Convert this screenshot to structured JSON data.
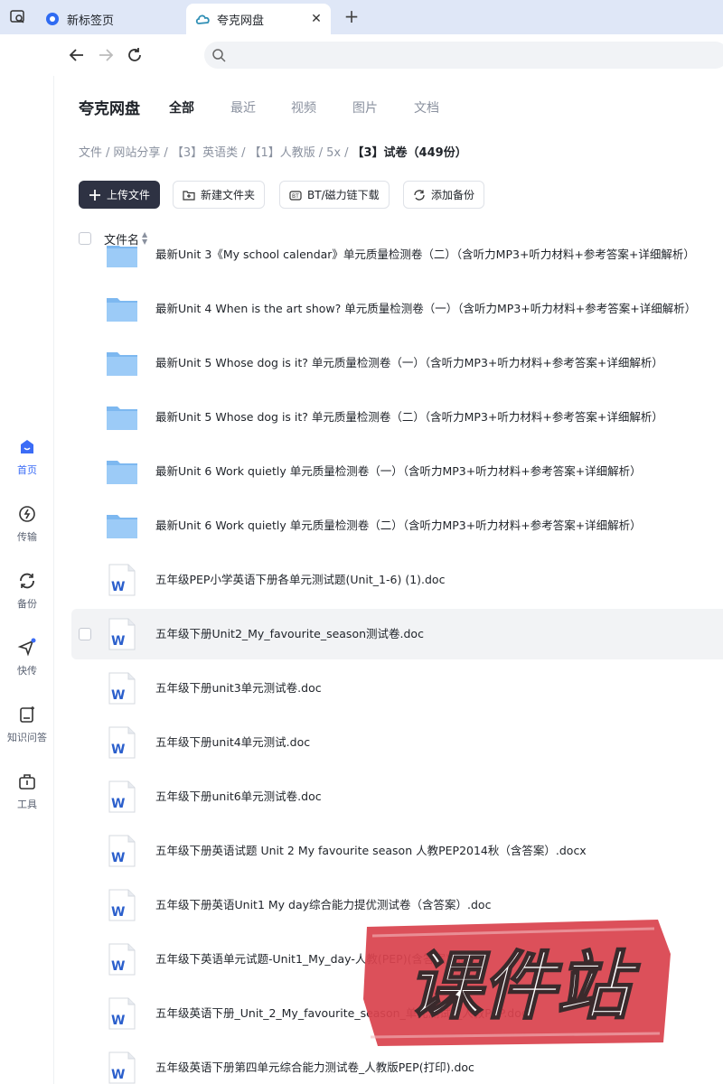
{
  "browser": {
    "tabs": [
      {
        "label": "新标签页",
        "active": false
      },
      {
        "label": "夸克网盘",
        "active": true
      }
    ],
    "new_tab_label": "+",
    "close_label": "✕"
  },
  "rail": {
    "items": [
      {
        "label": "首页",
        "icon": "home-icon",
        "active": true
      },
      {
        "label": "传输",
        "icon": "transfer-icon",
        "active": false
      },
      {
        "label": "备份",
        "icon": "backup-icon",
        "active": false
      },
      {
        "label": "快传",
        "icon": "quick-send-icon",
        "active": false
      },
      {
        "label": "知识问答",
        "icon": "qa-icon",
        "active": false
      },
      {
        "label": "工具",
        "icon": "toolbox-icon",
        "active": false
      }
    ]
  },
  "header": {
    "brand": "夸克网盘",
    "categories": [
      "全部",
      "最近",
      "视频",
      "图片",
      "文档"
    ]
  },
  "breadcrumb": [
    "文件",
    "网站分享",
    "【3】英语类",
    "【1】人教版",
    "5x",
    "【3】试卷（449份）"
  ],
  "toolbar": {
    "upload": "上传文件",
    "new_folder": "新建文件夹",
    "bt": "BT/磁力链下载",
    "backup": "添加备份"
  },
  "list_header": {
    "name": "文件名"
  },
  "files": [
    {
      "name": "最新Unit 3《My school calendar》单元质量检测卷（二）（含听力MP3+听力材料+参考答案+详细解析）",
      "type": "folder"
    },
    {
      "name": "最新Unit 4 When is the art show?  单元质量检测卷（一）（含听力MP3+听力材料+参考答案+详细解析）",
      "type": "folder"
    },
    {
      "name": "最新Unit 5 Whose dog is it?  单元质量检测卷（一）（含听力MP3+听力材料+参考答案+详细解析）",
      "type": "folder"
    },
    {
      "name": "最新Unit 5 Whose dog is it?  单元质量检测卷（二）（含听力MP3+听力材料+参考答案+详细解析）",
      "type": "folder"
    },
    {
      "name": "最新Unit 6 Work quietly 单元质量检测卷（一）（含听力MP3+听力材料+参考答案+详细解析）",
      "type": "folder"
    },
    {
      "name": "最新Unit 6 Work quietly 单元质量检测卷（二）（含听力MP3+听力材料+参考答案+详细解析）",
      "type": "folder"
    },
    {
      "name": "五年级PEP小学英语下册各单元测试题(Unit_1-6) (1).doc",
      "type": "doc"
    },
    {
      "name": "五年级下册Unit2_My_favourite_season测试卷.doc",
      "type": "doc"
    },
    {
      "name": "五年级下册unit3单元测试卷.doc",
      "type": "doc"
    },
    {
      "name": "五年级下册unit4单元测试.doc",
      "type": "doc"
    },
    {
      "name": "五年级下册unit6单元测试卷.doc",
      "type": "doc"
    },
    {
      "name": "五年级下册英语试题 Unit 2   My favourite season 人教PEP2014秋（含答案）.docx",
      "type": "doc"
    },
    {
      "name": "五年级下册英语Unit1 My day综合能力提优测试卷（含答案）.doc",
      "type": "doc"
    },
    {
      "name": "五年级下英语单元试题-Unit1_My_day-人教(PEP)(含答案).doc",
      "type": "doc"
    },
    {
      "name": "五年级英语下册_Unit_2_My_favourite_season_单元测试__人教PEP.doc",
      "type": "doc"
    },
    {
      "name": "五年级英语下册第四单元综合能力测试卷_人教版PEP(打印).doc",
      "type": "doc"
    }
  ],
  "watermark": {
    "text": "课件站"
  },
  "colors": {
    "accent": "#3b6cf6",
    "primary_button": "#2e3243",
    "folder": "#8fc3f5",
    "word": "#2b5fcc",
    "watermark": "#d9434e"
  }
}
